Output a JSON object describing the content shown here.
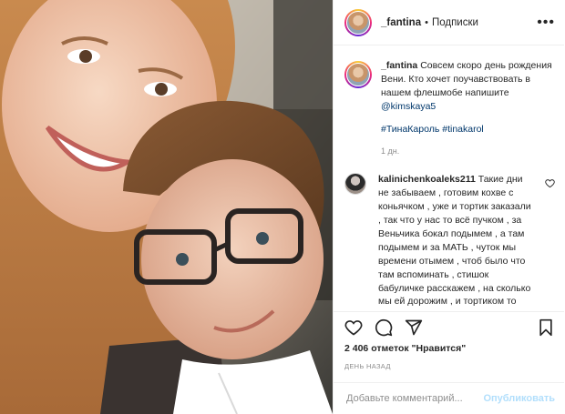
{
  "header": {
    "username": "_fantina",
    "separator": "•",
    "follow_label": "Подписки",
    "more_icon": "more-horizontal-icon"
  },
  "caption": {
    "username": "_fantina",
    "text": "Совсем скоро день рождения Вени. Кто хочет поучавствовать в нашем флешмобе напишите",
    "mention": "@kimskaya5",
    "hashtag_1": "#ТинаКароль",
    "hashtag_2": "#tinakarol",
    "time": "1 дн."
  },
  "comment": {
    "username": "kalinichenkoaleks211",
    "text": "Такие дни не забываем , готовим кохве с коньячком , уже и тортик заказали , так что у нас то всё пучком , за Веньчика бокал подымем , а там подымем и за МАТЬ , чуток мы времени отымем , чтоб было что там вспоминать , стишок бабуличке расскажем , на сколько мы ей дорожим , и тортиком то всё"
  },
  "actions": {
    "like_icon": "heart-icon",
    "comment_icon": "comment-bubble-icon",
    "share_icon": "paper-plane-icon",
    "save_icon": "bookmark-icon"
  },
  "likes_text": "2 406 отметок \"Нравится\"",
  "date_text": "ДЕНЬ НАЗАД",
  "add_comment": {
    "placeholder": "Добавьте комментарий...",
    "publish_label": "Опубликовать"
  },
  "colors": {
    "link": "#00376b",
    "publish_disabled": "#b2dffc",
    "secondary_text": "#8e8e8e"
  }
}
